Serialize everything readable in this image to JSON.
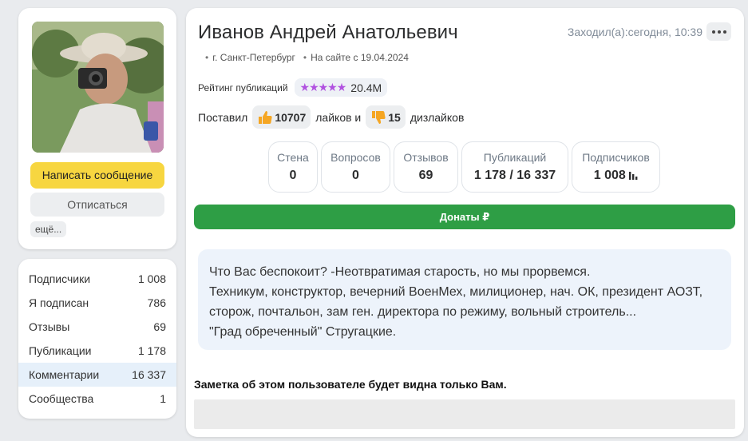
{
  "profile": {
    "write_message_label": "Написать сообщение",
    "unsubscribe_label": "Отписаться",
    "more_label": "ещё..."
  },
  "sidebar_stats": [
    {
      "label": "Подписчики",
      "value": "1 008"
    },
    {
      "label": "Я подписан",
      "value": "786"
    },
    {
      "label": "Отзывы",
      "value": "69"
    },
    {
      "label": "Публикации",
      "value": "1 178"
    },
    {
      "label": "Комментарии",
      "value": "16 337",
      "active": true
    },
    {
      "label": "Сообщества",
      "value": "1"
    }
  ],
  "header": {
    "name": "Иванов Андрей Анатольевич",
    "last_seen": "Заходил(а):сегодня, 10:39",
    "city": "г. Санкт-Петербург",
    "member_since": "На сайте с 19.04.2024"
  },
  "rating": {
    "label": "Рейтинг публикаций",
    "stars": "★★★★★",
    "value": "20.4M",
    "star_color": "#b152e0"
  },
  "likes": {
    "prefix": "Поставил",
    "likes_count": "10707",
    "likes_word": "лайков и",
    "dislikes_count": "15",
    "dislikes_word": "дизлайков",
    "thumb_color": "#f5a623"
  },
  "counters": [
    {
      "label": "Стена",
      "value": "0"
    },
    {
      "label": "Вопросов",
      "value": "0"
    },
    {
      "label": "Отзывов",
      "value": "69"
    },
    {
      "label": "Публикаций",
      "value": "1 178 / 16 337"
    },
    {
      "label": "Подписчиков",
      "value": "1 008",
      "icon": "bar-chart-icon"
    }
  ],
  "donate_label": "Донаты ₽",
  "donate_color": "#2e9e45",
  "about": [
    "Что Вас беспокоит? -Неотвратимая старость, но мы прорвемся.",
    "Техникум, конструктор, вечерний ВоенМех, милиционер, нач. ОК, президент АОЗТ,",
    "сторож, почтальон, зам ген. директора по режиму, вольный строитель...",
    "\"Град обреченный\" Стругацкие."
  ],
  "note_label": "Заметка об этом пользователе будет видна только Вам."
}
